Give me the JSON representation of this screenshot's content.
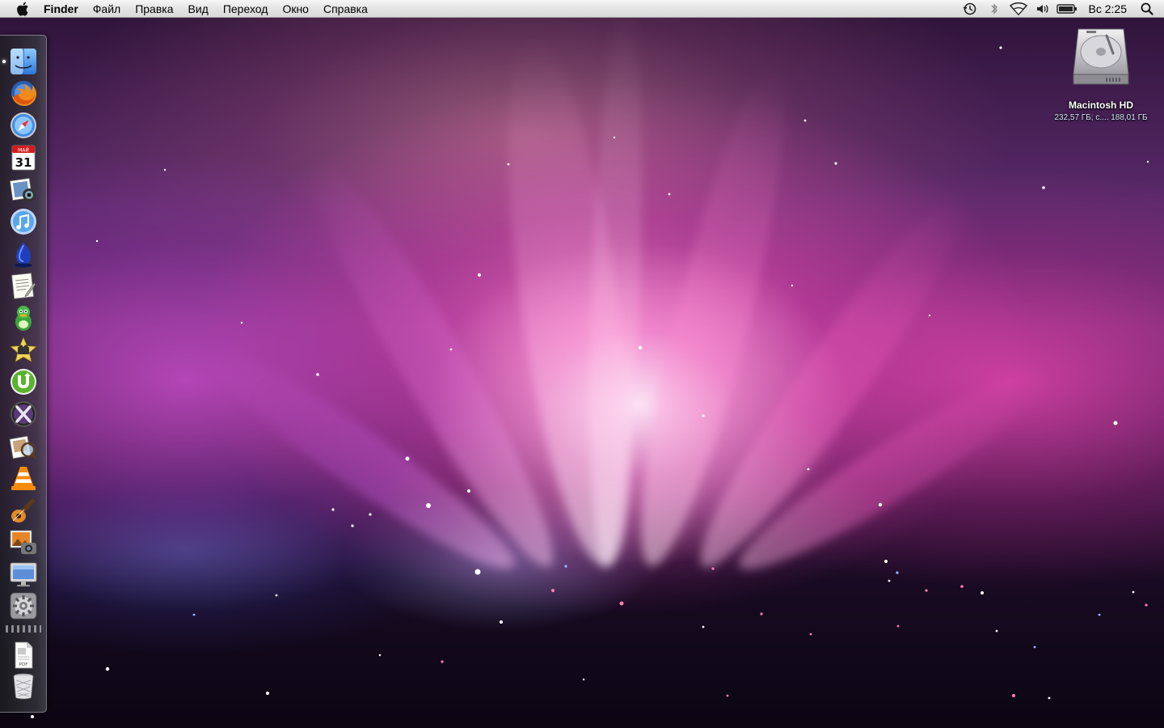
{
  "menubar": {
    "apple_icon": "apple-logo-icon",
    "app_name": "Finder",
    "menus": [
      "Файл",
      "Правка",
      "Вид",
      "Переход",
      "Окно",
      "Справка"
    ],
    "status_icons": [
      "time-machine-icon",
      "bluetooth-icon",
      "wifi-icon",
      "volume-icon",
      "battery-icon"
    ],
    "clock": "Вс 2:25",
    "spotlight_icon": "spotlight-search-icon"
  },
  "dock": {
    "position": "left",
    "apps": [
      {
        "icon": "finder-icon",
        "running": true
      },
      {
        "icon": "firefox-icon",
        "running": false
      },
      {
        "icon": "safari-icon",
        "running": false
      },
      {
        "icon": "ical-icon",
        "running": false
      },
      {
        "icon": "photo-booth-icon",
        "running": false
      },
      {
        "icon": "itunes-icon",
        "running": false
      },
      {
        "icon": "adium-duck-icon",
        "running": false
      },
      {
        "icon": "textedit-icon",
        "running": false
      },
      {
        "icon": "adium-icon",
        "running": false
      },
      {
        "icon": "imovie-icon",
        "running": false
      },
      {
        "icon": "utorrent-icon",
        "running": false
      },
      {
        "icon": "mac-os-x-icon",
        "running": false
      },
      {
        "icon": "preview-icon",
        "running": false
      },
      {
        "icon": "vlc-icon",
        "running": false
      },
      {
        "icon": "garageband-icon",
        "running": false
      },
      {
        "icon": "iphoto-icon",
        "running": false
      },
      {
        "icon": "display-icon",
        "running": false
      },
      {
        "icon": "system-preferences-icon",
        "running": false
      }
    ],
    "calendar_month": "МАЙ",
    "calendar_day": "31",
    "stacks": [
      {
        "icon": "pdf-document-icon",
        "label": "PDF"
      },
      {
        "icon": "trash-icon"
      }
    ]
  },
  "desktop": {
    "wallpaper": "aurora-purple-pink",
    "drive": {
      "name": "Macintosh HD",
      "info": "232,57 ГБ; с.... 188,01 ГБ"
    }
  },
  "colors": {
    "menubar_top": "#f6f6f6",
    "menubar_bottom": "#d9d9d9",
    "aurora_pink": "#ff6ec7",
    "aurora_purple": "#8a3fb0",
    "space_dark": "#14081c"
  }
}
